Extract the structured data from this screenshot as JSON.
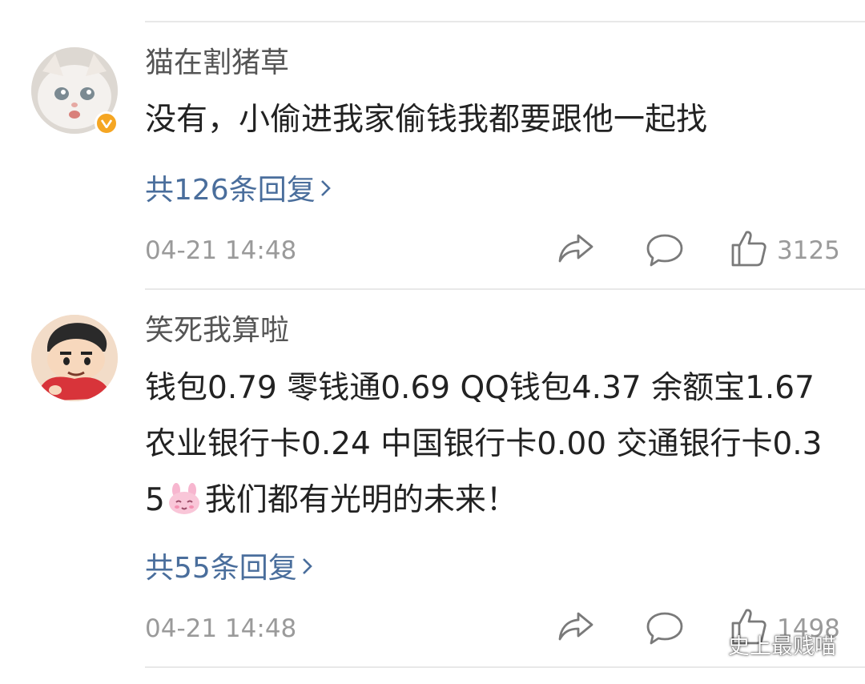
{
  "comments": [
    {
      "username": "猫在割猪草",
      "verified": true,
      "text": "没有，小偷进我家偷钱我都要跟他一起找",
      "replies_label": "共126条回复",
      "timestamp": "04-21 14:48",
      "likes": "3125",
      "avatar_icon": "cat-avatar"
    },
    {
      "username": "笑死我算啦",
      "verified": false,
      "text_before_emoji": "钱包0.79 零钱通0.69 QQ钱包4.37 余额宝1.67 农业银行卡0.24 中国银行卡0.00 交通银行卡0.35",
      "text_after_emoji": "我们都有光明的未来！",
      "replies_label": "共55条回复",
      "timestamp": "04-21 14:48",
      "likes": "1498",
      "avatar_icon": "cartoon-boy-avatar"
    }
  ],
  "watermark": {
    "text": "史上最贱喵",
    "icon": "wechat-icon"
  },
  "colors": {
    "link": "#4a6e9c",
    "meta": "#9a9a9a",
    "verified_badge": "#f5a623"
  }
}
